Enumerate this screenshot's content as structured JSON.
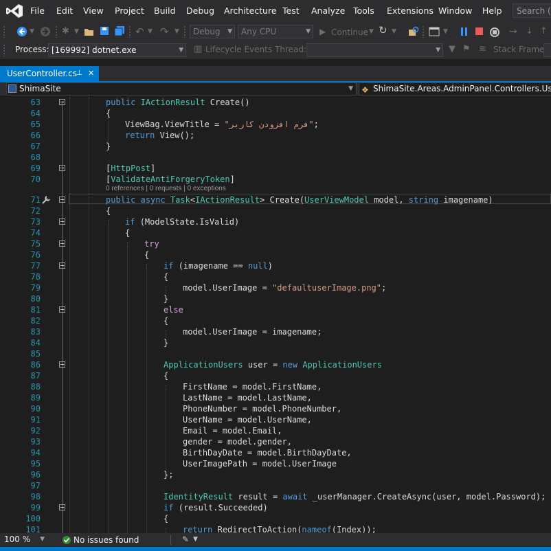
{
  "menu": {
    "items": [
      "File",
      "Edit",
      "View",
      "Project",
      "Build",
      "Debug",
      "Architecture",
      "Test",
      "Analyze",
      "Tools",
      "Extensions",
      "Window",
      "Help"
    ],
    "search_placeholder": "Search (C"
  },
  "toolbar": {
    "config_value": "Debug",
    "platform_value": "Any CPU",
    "continue_label": "Continue",
    "icons": [
      "back-icon",
      "forward-icon",
      "new-project-icon",
      "open-icon",
      "save-icon",
      "save-all-icon",
      "undo-icon",
      "redo-icon",
      "continue-icon",
      "refresh-icon",
      "find-icon",
      "browser-icon",
      "pause-icon",
      "stop-icon",
      "restart-icon",
      "step-icon"
    ]
  },
  "process_bar": {
    "process_label": "Process:",
    "process_value": "[169992] dotnet.exe",
    "lifecycle_label": "Lifecycle Events",
    "thread_label": "Thread:",
    "stackframe_label": "Stack Frame:"
  },
  "tab": {
    "label": "UserController.cs",
    "pin_glyph": "⊥",
    "close_glyph": "✕"
  },
  "nav": {
    "project": "ShimaSite",
    "class_path": "ShimaSite.Areas.AdminPanel.Controllers.UserCon"
  },
  "codelens": "0 references | 0 requests | 0 exceptions",
  "editor": {
    "lines": [
      {
        "n": "63",
        "fold": true,
        "code": "<span class='kw'>public</span> <span class='ty'>IActionResult</span> <span class='tx'>Create()</span>",
        "indent": 154
      },
      {
        "n": "64",
        "fold": false,
        "code": "<span class='tx'>{</span>",
        "indent": 154
      },
      {
        "n": "65",
        "fold": false,
        "code": "<span class='tx'>ViewBag.ViewTitle = </span><span class='st'>\"فرم افزودن کاربر\"</span><span class='tx'>;</span>",
        "indent": 182
      },
      {
        "n": "66",
        "fold": false,
        "code": "<span class='kw'>return</span> <span class='tx'>View();</span>",
        "indent": 182
      },
      {
        "n": "67",
        "fold": false,
        "code": "<span class='tx'>}</span>",
        "indent": 154
      },
      {
        "n": "68",
        "fold": false,
        "code": "",
        "indent": 154
      },
      {
        "n": "69",
        "fold": true,
        "code": "<span class='tx'>[</span><span class='ty'>HttpPost</span><span class='tx'>]</span>",
        "indent": 154
      },
      {
        "n": "70",
        "fold": false,
        "code": "<span class='tx'>[</span><span class='ty'>ValidateAntiForgeryToken</span><span class='tx'>]</span>",
        "indent": 154
      },
      {
        "n": "71",
        "fold": true,
        "code": "<span class='kw'>public</span> <span class='kw'>async</span> <span class='ty'>Task</span><span class='tx'>&lt;</span><span class='ty'>IActionResult</span><span class='tx'>&gt; Create(</span><span class='ty'>UserViewModel</span> <span class='tx'>model, </span><span class='kw'>string</span> <span class='tx'>imagename)</span>",
        "indent": 154
      },
      {
        "n": "72",
        "fold": false,
        "code": "<span class='tx'>{</span>",
        "indent": 154
      },
      {
        "n": "73",
        "fold": true,
        "code": "<span class='kw'>if</span> <span class='tx'>(ModelState.IsValid)</span>",
        "indent": 182
      },
      {
        "n": "74",
        "fold": false,
        "code": "<span class='tx'>{</span>",
        "indent": 182
      },
      {
        "n": "75",
        "fold": true,
        "code": "<span class='ctl'>try</span>",
        "indent": 210
      },
      {
        "n": "76",
        "fold": false,
        "code": "<span class='tx'>{</span>",
        "indent": 210
      },
      {
        "n": "77",
        "fold": true,
        "code": "<span class='kw'>if</span> <span class='tx'>(imagename == </span><span class='kw'>null</span><span class='tx'>)</span>",
        "indent": 238
      },
      {
        "n": "78",
        "fold": false,
        "code": "<span class='tx'>{</span>",
        "indent": 238
      },
      {
        "n": "79",
        "fold": false,
        "code": "<span class='tx'>model.UserImage = </span><span class='st'>\"defaultuserImage.png\"</span><span class='tx'>;</span>",
        "indent": 266
      },
      {
        "n": "80",
        "fold": false,
        "code": "<span class='tx'>}</span>",
        "indent": 238
      },
      {
        "n": "81",
        "fold": true,
        "code": "<span class='ctl'>else</span>",
        "indent": 238
      },
      {
        "n": "82",
        "fold": false,
        "code": "<span class='tx'>{</span>",
        "indent": 238
      },
      {
        "n": "83",
        "fold": false,
        "code": "<span class='tx'>model.UserImage = imagename;</span>",
        "indent": 266
      },
      {
        "n": "84",
        "fold": false,
        "code": "<span class='tx'>}</span>",
        "indent": 238
      },
      {
        "n": "85",
        "fold": false,
        "code": "",
        "indent": 238
      },
      {
        "n": "86",
        "fold": true,
        "code": "<span class='ty'>ApplicationUsers</span> <span class='tx'>user = </span><span class='kw'>new</span> <span class='ty'>ApplicationUsers</span>",
        "indent": 238
      },
      {
        "n": "87",
        "fold": false,
        "code": "<span class='tx'>{</span>",
        "indent": 238
      },
      {
        "n": "88",
        "fold": false,
        "code": "<span class='tx'>FirstName = model.FirstName,</span>",
        "indent": 266
      },
      {
        "n": "89",
        "fold": false,
        "code": "<span class='tx'>LastName = model.LastName,</span>",
        "indent": 266
      },
      {
        "n": "90",
        "fold": false,
        "code": "<span class='tx'>PhoneNumber = model.PhoneNumber,</span>",
        "indent": 266
      },
      {
        "n": "91",
        "fold": false,
        "code": "<span class='tx'>UserName = model.UserName,</span>",
        "indent": 266
      },
      {
        "n": "92",
        "fold": false,
        "code": "<span class='tx'>Email = model.Email,</span>",
        "indent": 266
      },
      {
        "n": "93",
        "fold": false,
        "code": "<span class='tx'>gender = model.gender,</span>",
        "indent": 266
      },
      {
        "n": "94",
        "fold": false,
        "code": "<span class='tx'>BirthDayDate = model.BirthDayDate,</span>",
        "indent": 266
      },
      {
        "n": "95",
        "fold": false,
        "code": "<span class='tx'>UserImagePath = model.UserImage</span>",
        "indent": 266
      },
      {
        "n": "96",
        "fold": false,
        "code": "<span class='tx'>};</span>",
        "indent": 238
      },
      {
        "n": "97",
        "fold": false,
        "code": "",
        "indent": 238
      },
      {
        "n": "98",
        "fold": false,
        "code": "<span class='ty'>IdentityResult</span> <span class='tx'>result = </span><span class='kw'>await</span> <span class='tx'>_userManager.CreateAsync(user, model.Password);</span>",
        "indent": 238
      },
      {
        "n": "99",
        "fold": true,
        "code": "<span class='kw'>if</span> <span class='tx'>(result.Succeeded)</span>",
        "indent": 238
      },
      {
        "n": "100",
        "fold": false,
        "code": "<span class='tx'>{</span>",
        "indent": 238
      },
      {
        "n": "101",
        "fold": false,
        "code": "<span class='kw'>return</span> <span class='tx'>RedirectToAction(</span><span class='kw'>nameof</span><span class='tx'>(Index));</span>",
        "indent": 266
      }
    ]
  },
  "status": {
    "zoom": "100 %",
    "issues": "No issues found"
  },
  "colors": {
    "accent": "#007acc",
    "editor_bg": "#1e1e1e",
    "chrome_bg": "#2d2d30",
    "keyword": "#569cd6",
    "type": "#4ec9b0",
    "string": "#d69d85",
    "line_number": "#2b91af"
  }
}
